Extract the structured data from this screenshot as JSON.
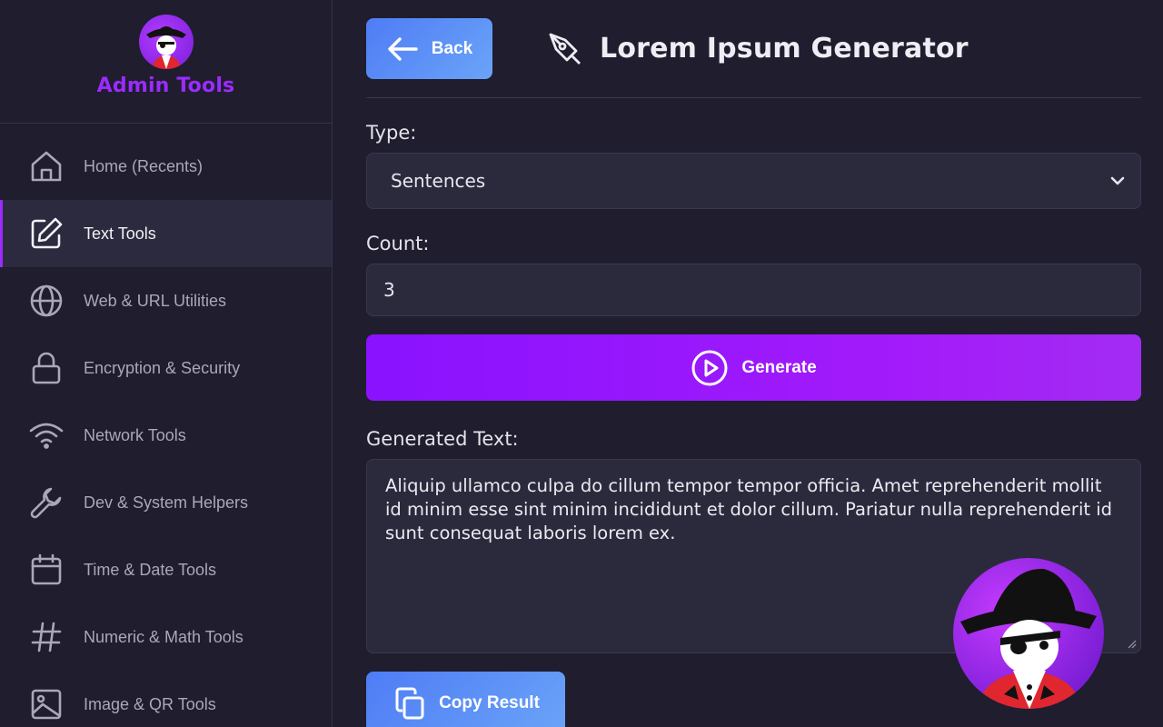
{
  "brand": {
    "title": "Admin Tools"
  },
  "sidebar": {
    "items": [
      {
        "label": "Home (Recents)",
        "icon": "home-icon",
        "active": false
      },
      {
        "label": "Text Tools",
        "icon": "edit-icon",
        "active": true
      },
      {
        "label": "Web & URL Utilities",
        "icon": "globe-icon",
        "active": false
      },
      {
        "label": "Encryption & Security",
        "icon": "lock-icon",
        "active": false
      },
      {
        "label": "Network Tools",
        "icon": "wifi-icon",
        "active": false
      },
      {
        "label": "Dev & System Helpers",
        "icon": "wrench-icon",
        "active": false
      },
      {
        "label": "Time & Date Tools",
        "icon": "calendar-icon",
        "active": false
      },
      {
        "label": "Numeric & Math Tools",
        "icon": "hash-icon",
        "active": false
      },
      {
        "label": "Image & QR Tools",
        "icon": "image-icon",
        "active": false
      }
    ]
  },
  "header": {
    "back_label": "Back",
    "title": "Lorem Ipsum Generator",
    "title_icon": "pen-nib-icon"
  },
  "form": {
    "type_label": "Type:",
    "type_value": "Sentences",
    "count_label": "Count:",
    "count_value": "3",
    "generate_label": "Generate",
    "output_label": "Generated Text:",
    "output_value": "Aliquip ullamco culpa do cillum tempor tempor officia. Amet reprehenderit mollit id minim esse sint minim incididunt et dolor cillum. Pariatur nulla reprehenderit id sunt consequat laboris lorem ex.",
    "copy_label": "Copy Result"
  },
  "colors": {
    "accent_purple": "#9b2bff",
    "blue_button": "#5a8ef6",
    "background": "#1f1d2e"
  }
}
